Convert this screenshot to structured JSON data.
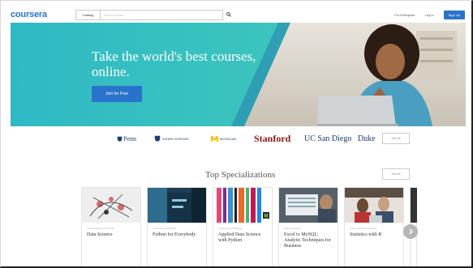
{
  "header": {
    "logo": "coursera",
    "catalog_label": "Catalog",
    "search_placeholder": "Find a course",
    "for_enterprise": "For Enterprise",
    "log_in": "Log In",
    "sign_up": "Sign Up"
  },
  "hero": {
    "title": "Take the world's best courses, online.",
    "cta": "Join for Free"
  },
  "partners": {
    "items": [
      "Penn",
      "JOHNS HOPKINS",
      "MICHIGAN",
      "Stanford",
      "UC San Diego",
      "Duke"
    ],
    "see_all": "See All"
  },
  "specializations": {
    "title": "Top Specializations",
    "see_all": "See All",
    "cards": [
      {
        "subtitle": "Johns Hopkins University",
        "title": "Data Science"
      },
      {
        "subtitle": "University of Michigan",
        "title": "Python for Everybody"
      },
      {
        "subtitle": "University of Michigan",
        "title": "Applied Data Science with Python"
      },
      {
        "subtitle": "Duke University",
        "title": "Excel to MySQL: Analytic Techniques for Business"
      },
      {
        "subtitle": "Johns Hopkins University",
        "title": "Statistics with R"
      }
    ]
  },
  "icons": {
    "search": "search-icon",
    "next": "chevron-right-icon"
  },
  "colors": {
    "brand": "#2a73cc",
    "hero_teal": "#35c1c5",
    "stanford": "#8c1515"
  }
}
